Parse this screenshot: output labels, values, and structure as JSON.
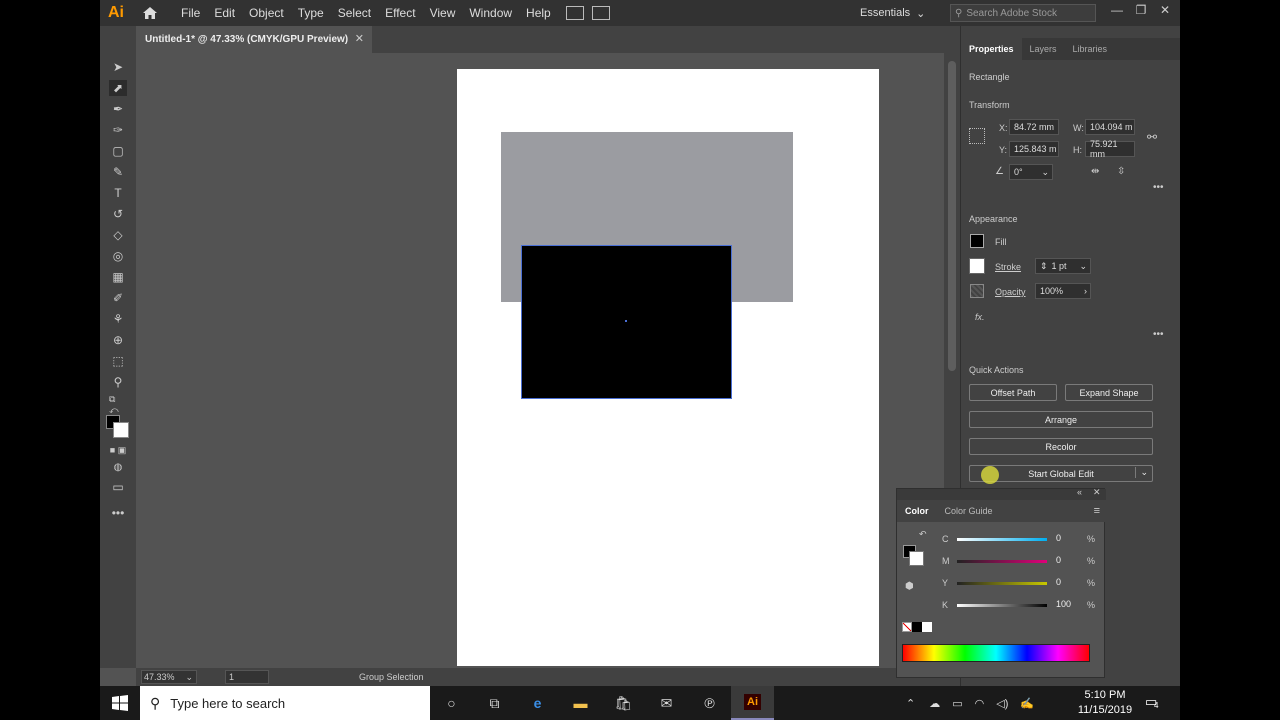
{
  "app": {
    "logo": "Ai",
    "menus": [
      "File",
      "Edit",
      "Object",
      "Type",
      "Select",
      "Effect",
      "View",
      "Window",
      "Help"
    ],
    "workspace": "Essentials",
    "search_placeholder": "Search Adobe Stock",
    "document_tab": "Untitled-1* @ 47.33% (CMYK/GPU Preview)"
  },
  "status": {
    "zoom": "47.33%",
    "page": "1",
    "tool": "Group Selection"
  },
  "properties": {
    "tabs": [
      "Properties",
      "Layers",
      "Libraries"
    ],
    "object_type": "Rectangle",
    "transform_title": "Transform",
    "x_label": "X:",
    "x": "84.72 mm",
    "w_label": "W:",
    "w": "104.094 m",
    "y_label": "Y:",
    "y": "125.843 m",
    "h_label": "H:",
    "h": "75.921 mm",
    "angle": "0°",
    "appearance_title": "Appearance",
    "fill_label": "Fill",
    "stroke_label": "Stroke",
    "stroke_value": "1 pt",
    "opacity_label": "Opacity",
    "opacity_value": "100%",
    "fx": "fx.",
    "quick_actions_title": "Quick Actions",
    "offset_path": "Offset Path",
    "expand_shape": "Expand Shape",
    "arrange": "Arrange",
    "recolor": "Recolor",
    "global_edit": "Start Global Edit"
  },
  "color_panel": {
    "tabs": [
      "Color",
      "Color Guide"
    ],
    "channels": [
      {
        "label": "C",
        "value": "0",
        "unit": "%"
      },
      {
        "label": "M",
        "value": "0",
        "unit": "%"
      },
      {
        "label": "Y",
        "value": "0",
        "unit": "%"
      },
      {
        "label": "K",
        "value": "100",
        "unit": "%"
      }
    ]
  },
  "taskbar": {
    "search_placeholder": "Type here to search",
    "time": "5:10 PM",
    "date": "11/15/2019",
    "notifications": "4"
  },
  "colors": {
    "ai_orange": "#FF9A00",
    "panel_bg": "#424242",
    "canvas_bg": "#535353",
    "gray_rect": "#9B9CA1"
  }
}
